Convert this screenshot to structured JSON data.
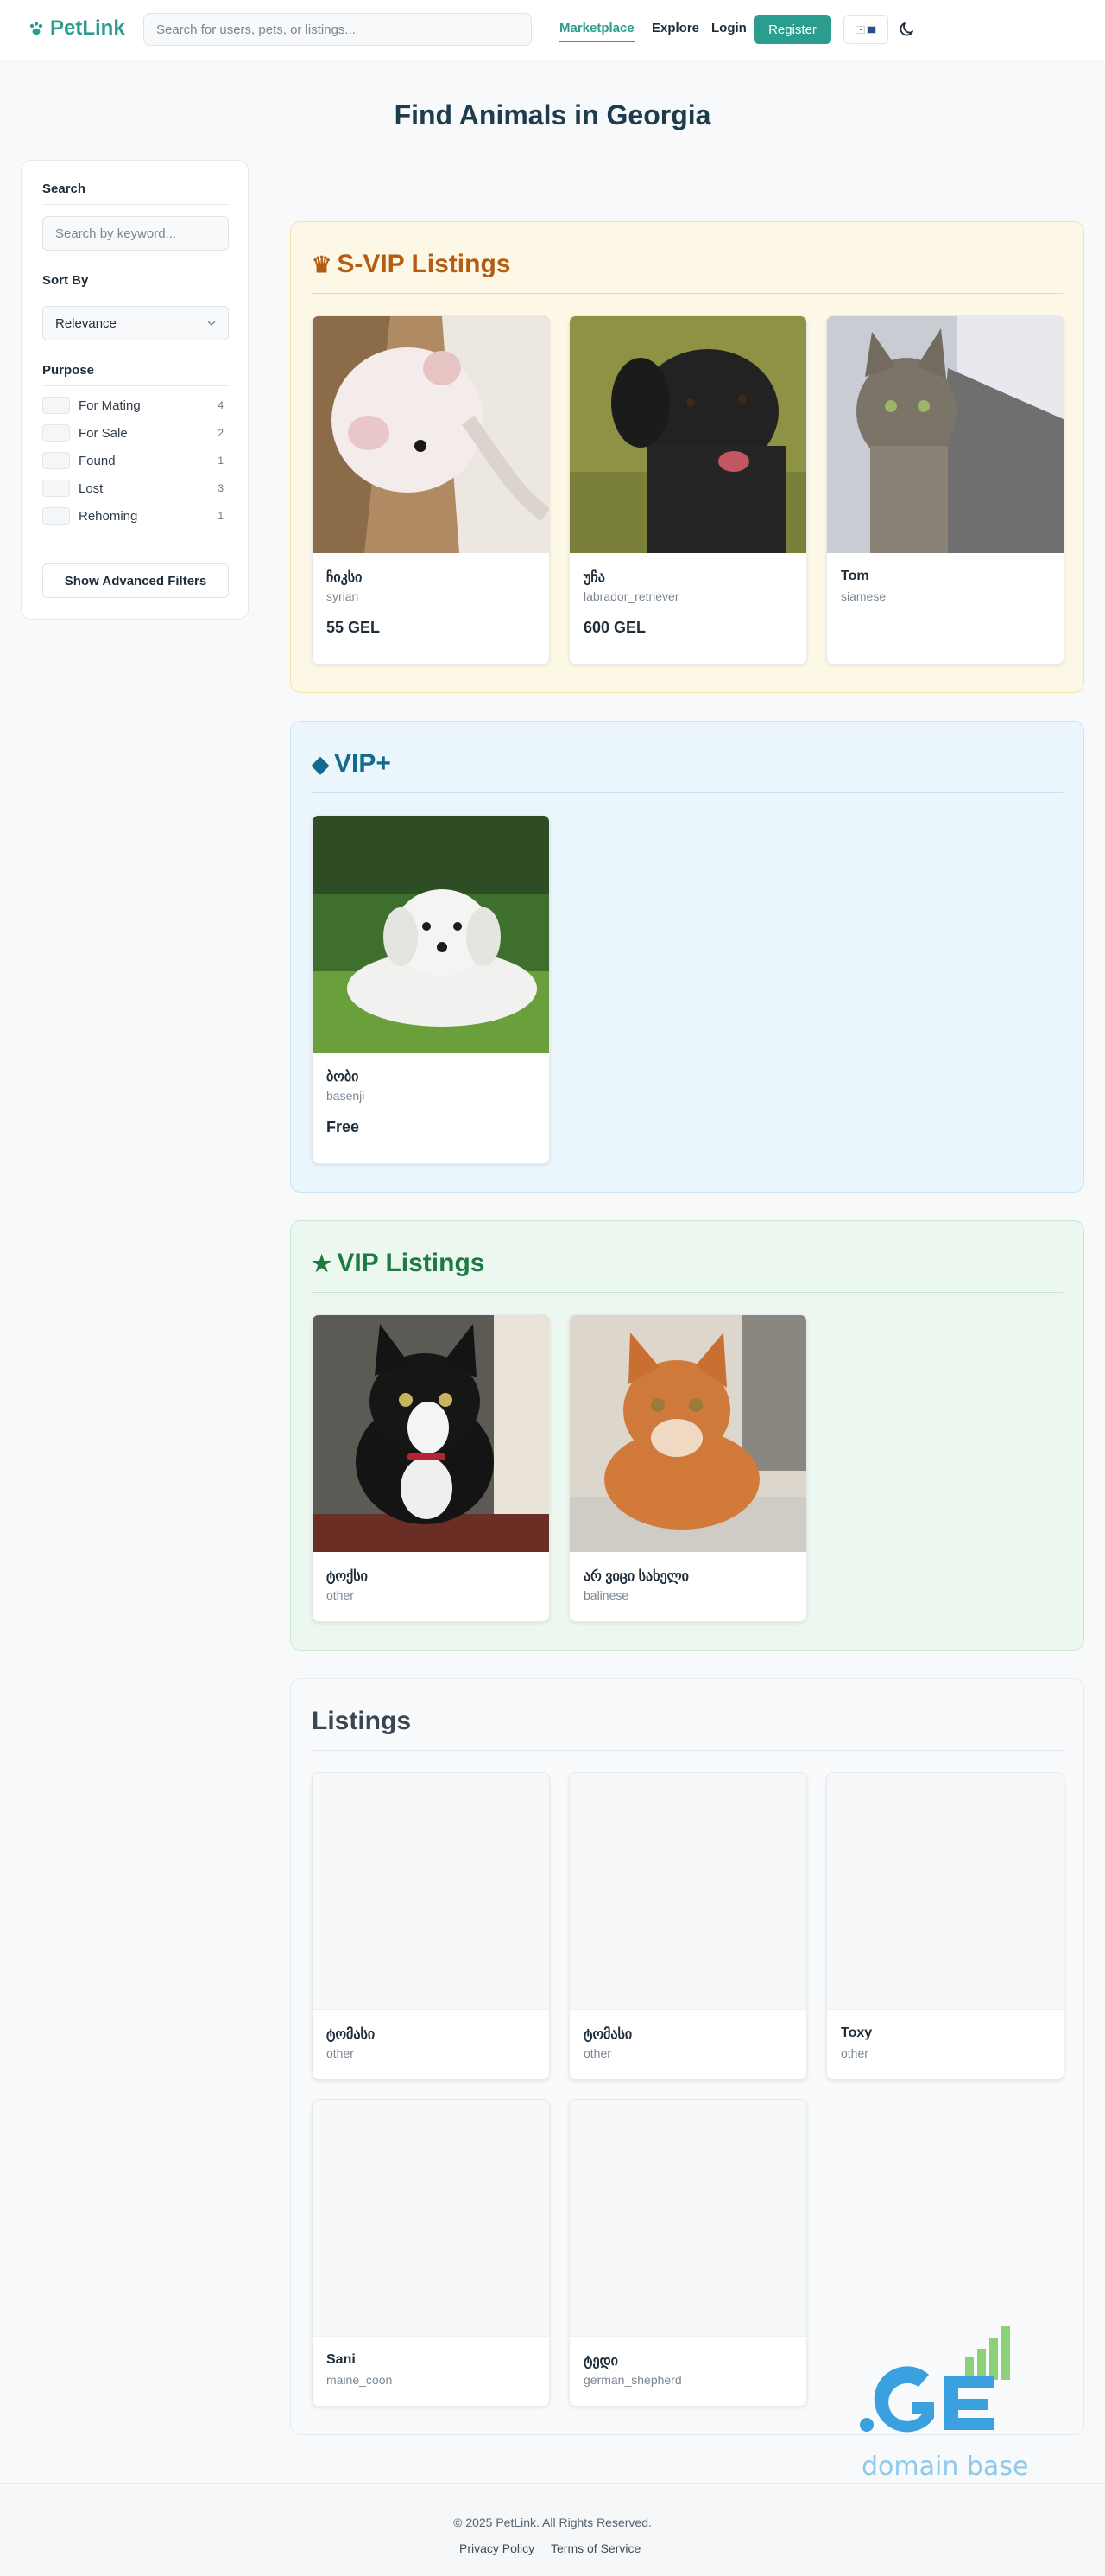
{
  "header": {
    "logo": "PetLink",
    "search_placeholder": "Search for users, pets, or listings...",
    "nav": [
      "Marketplace",
      "Explore",
      "Login"
    ],
    "register": "Register",
    "brand_color": "#2a9d8f"
  },
  "page_title": "Find Animals in Georgia",
  "sidebar": {
    "search_heading": "Search",
    "search_placeholder": "Search by keyword...",
    "sort_heading": "Sort By",
    "sort_value": "Relevance",
    "purpose_heading": "Purpose",
    "purposes": [
      {
        "label": "For Mating",
        "count": "4"
      },
      {
        "label": "For Sale",
        "count": "2"
      },
      {
        "label": "Found",
        "count": "1"
      },
      {
        "label": "Lost",
        "count": "3"
      },
      {
        "label": "Rehoming",
        "count": "1"
      }
    ],
    "advanced_button": "Show Advanced Filters"
  },
  "sections": {
    "svip": {
      "title": "S-VIP Listings",
      "color": "#b35c12",
      "cards": [
        {
          "name": "ჩიკსი",
          "breed": "syrian",
          "price": "55 GEL"
        },
        {
          "name": "უჩა",
          "breed": "labrador_retriever",
          "price": "600 GEL"
        },
        {
          "name": "Tom",
          "breed": "siamese",
          "price": ""
        }
      ]
    },
    "vipplus": {
      "title": "VIP+",
      "color": "#146a8c",
      "cards": [
        {
          "name": "ბობი",
          "breed": "basenji",
          "price": "Free"
        }
      ]
    },
    "vip": {
      "title": "VIP Listings",
      "color": "#1f7a42",
      "cards": [
        {
          "name": "ტოქსი",
          "breed": "other",
          "price": ""
        },
        {
          "name": "არ ვიცი სახელი",
          "breed": "balinese",
          "price": ""
        }
      ]
    },
    "listings": {
      "title": "Listings",
      "color": "#3a4650",
      "cards": [
        {
          "name": "ტომასი",
          "breed": "other"
        },
        {
          "name": "ტომასი",
          "breed": "other"
        },
        {
          "name": "Toxy",
          "breed": "other"
        },
        {
          "name": "Sani",
          "breed": "maine_coon"
        },
        {
          "name": "ტედი",
          "breed": "german_shepherd"
        }
      ]
    }
  },
  "footer": {
    "copyright": "© 2025 PetLink. All Rights Reserved.",
    "links": [
      "Privacy Policy",
      "Terms of Service"
    ]
  },
  "watermark": {
    "logo": ".GE",
    "text": "domain base"
  }
}
